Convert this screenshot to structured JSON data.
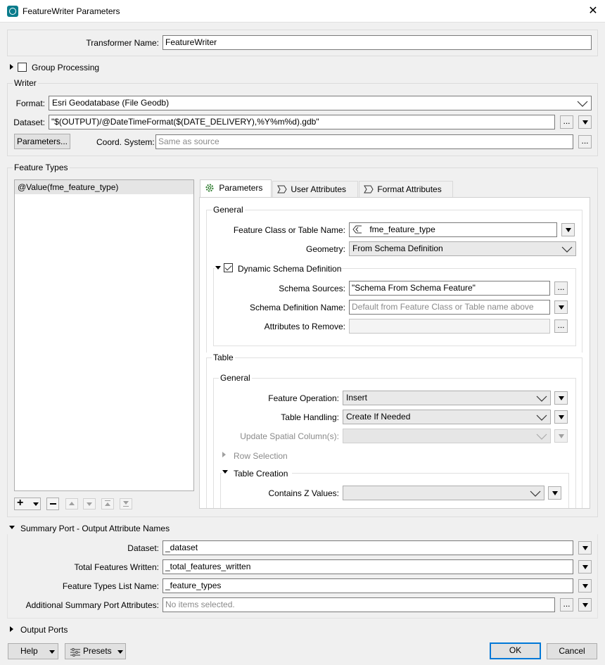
{
  "window": {
    "title": "FeatureWriter Parameters",
    "close": "✕"
  },
  "transformer_name": {
    "label": "Transformer Name:",
    "value": "FeatureWriter"
  },
  "group_processing": {
    "label": "Group Processing"
  },
  "writer": {
    "legend": "Writer",
    "format_label": "Format:",
    "format_value": "Esri Geodatabase (File Geodb)",
    "dataset_label": "Dataset:",
    "dataset_value": "\"$(OUTPUT)/@DateTimeFormat($(DATE_DELIVERY),%Y%m%d).gdb\"",
    "parameters_button": "Parameters...",
    "coord_label": "Coord. System:",
    "coord_placeholder": "Same as source",
    "browse": "..."
  },
  "feature_types": {
    "legend": "Feature Types",
    "items": [
      "@Value(fme_feature_type)"
    ],
    "toolbar_add": "+"
  },
  "tabs": [
    "Parameters",
    "User Attributes",
    "Format Attributes"
  ],
  "general": {
    "legend": "General",
    "fc_label": "Feature Class or Table Name:",
    "fc_value": "fme_feature_type",
    "geometry_label": "Geometry:",
    "geometry_value": "From Schema Definition",
    "dynamic_schema_label": "Dynamic Schema Definition",
    "schema_sources_label": "Schema Sources:",
    "schema_sources_value": "\"Schema From Schema Feature\"",
    "schema_def_name_label": "Schema Definition Name:",
    "schema_def_name_placeholder": "Default from Feature Class or Table name above",
    "attrs_remove_label": "Attributes to Remove:"
  },
  "table": {
    "legend": "Table",
    "general_legend": "General",
    "feature_op_label": "Feature Operation:",
    "feature_op_value": "Insert",
    "table_handling_label": "Table Handling:",
    "table_handling_value": "Create If Needed",
    "update_spatial_label": "Update Spatial Column(s):",
    "row_selection_label": "Row Selection",
    "table_creation_label": "Table Creation",
    "contains_z_label": "Contains Z Values:"
  },
  "summary": {
    "header": "Summary Port - Output Attribute Names",
    "dataset_label": "Dataset:",
    "dataset_value": "_dataset",
    "total_label": "Total Features Written:",
    "total_value": "_total_features_written",
    "ftlist_label": "Feature Types List Name:",
    "ftlist_value": "_feature_types",
    "additional_label": "Additional Summary Port Attributes:",
    "additional_placeholder": "No items selected."
  },
  "output_ports": {
    "header": "Output Ports"
  },
  "footer": {
    "help": "Help",
    "presets": "Presets",
    "ok": "OK",
    "cancel": "Cancel"
  }
}
